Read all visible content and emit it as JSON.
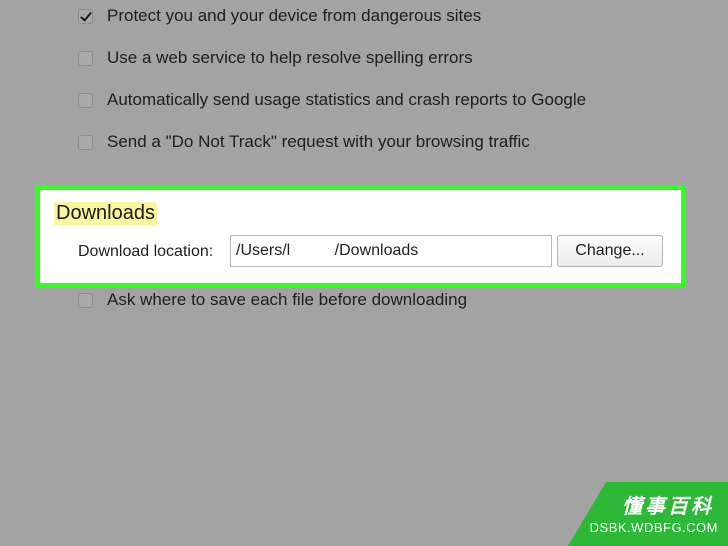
{
  "options": [
    {
      "label": "Protect you and your device from dangerous sites",
      "checked": true
    },
    {
      "label": "Use a web service to help resolve spelling errors",
      "checked": false
    },
    {
      "label": "Automatically send usage statistics and crash reports to Google",
      "checked": false
    },
    {
      "label": "Send a \"Do Not Track\" request with your browsing traffic",
      "checked": false
    }
  ],
  "downloads": {
    "heading": "Downloads",
    "location_label": "Download location:",
    "location_value": "/Users/l          /Downloads",
    "change_button": "Change...",
    "ask_option": {
      "label": "Ask where to save each file before downloading",
      "checked": false
    }
  },
  "watermark": {
    "title": "懂事百科",
    "subtitle": "DSBK.WDBFG.COM"
  },
  "colors": {
    "background": "#a3a3a3",
    "highlight_border": "#33ff1e",
    "heading_highlight": "#fbf5a0",
    "watermark": "#2db838"
  }
}
